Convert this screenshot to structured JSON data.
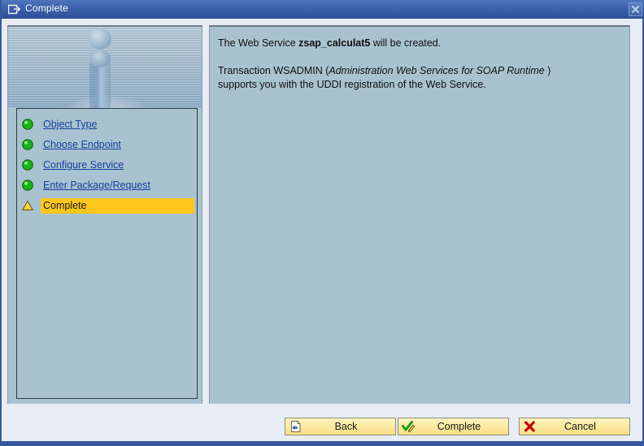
{
  "window": {
    "title": "Complete",
    "title_icon": "window-export-icon",
    "close_icon": "close-icon"
  },
  "sidebar": {
    "art_name": "water-droplet-splash-image",
    "steps": [
      {
        "label": "Object Type",
        "icon": "green-circle-icon",
        "state": "done"
      },
      {
        "label": "Choose Endpoint",
        "icon": "green-circle-icon",
        "state": "done"
      },
      {
        "label": "Configure Service",
        "icon": "green-circle-icon",
        "state": "done"
      },
      {
        "label": "Enter Package/Request",
        "icon": "green-circle-icon",
        "state": "done"
      },
      {
        "label": "Complete",
        "icon": "yellow-triangle-icon",
        "state": "current"
      }
    ]
  },
  "content": {
    "line1_part1": "The Web Service ",
    "line1_service": "zsap_calculat5",
    "line1_part2": " will be created.",
    "line2_part1": "Transaction WSADMIN (",
    "line2_italic": "Administration Web Services for SOAP Runtime",
    "line2_part2": " )",
    "line3": "supports you with the UDDI registration of the Web Service."
  },
  "footer": {
    "buttons": [
      {
        "label": "Back",
        "icon": "back-document-icon"
      },
      {
        "label": "Complete",
        "icon": "check-pencil-icon"
      },
      {
        "label": "Cancel",
        "icon": "red-x-icon"
      }
    ]
  },
  "colors": {
    "titlebar": "#3d61ab",
    "panel_bg": "#a9c2d0",
    "highlight": "#ffc61e",
    "link": "#15409c",
    "button_face": "#fbeaa0",
    "footer_bg": "#e8edf5"
  }
}
